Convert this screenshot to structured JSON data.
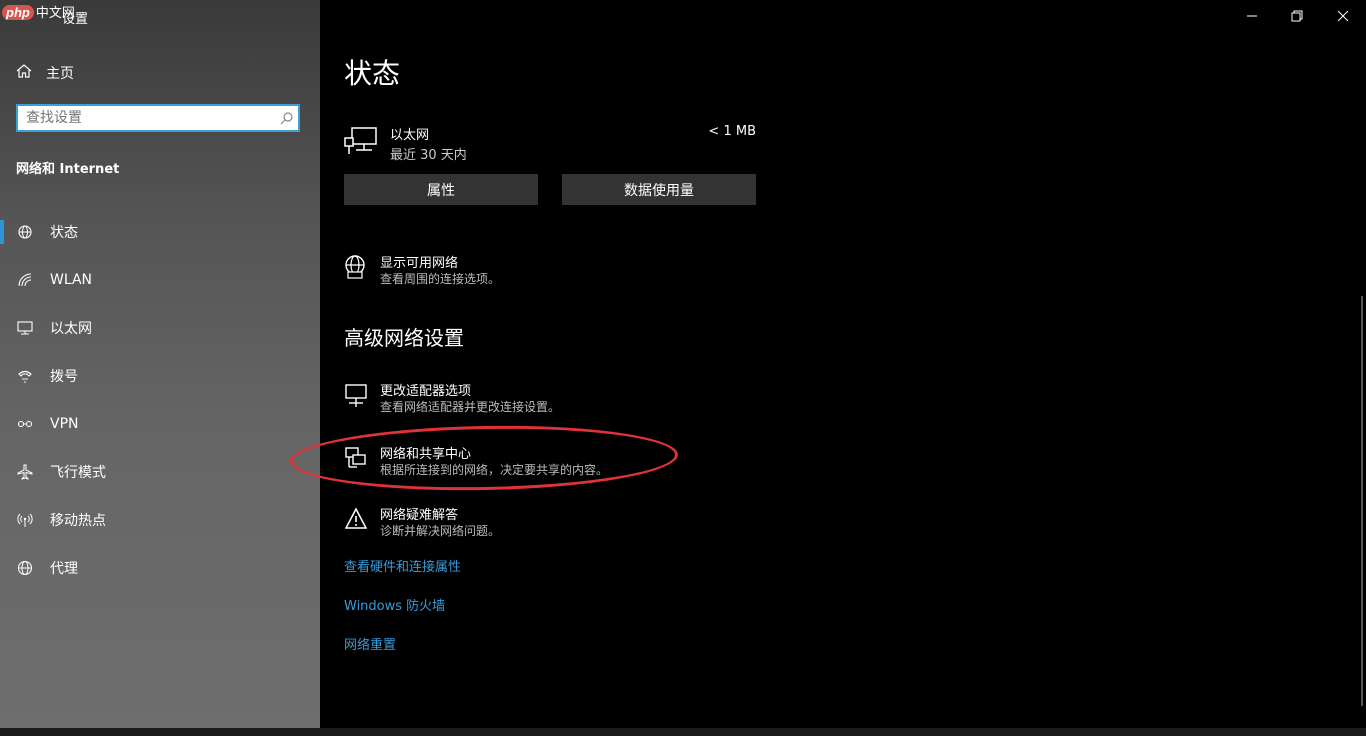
{
  "watermark": {
    "brand": "php",
    "site": "中文网"
  },
  "window": {
    "title": "设置"
  },
  "sidebar": {
    "home_label": "主页",
    "search_placeholder": "查找设置",
    "section_title": "网络和 Internet",
    "items": [
      {
        "label": "状态",
        "icon": "status-icon",
        "active": true
      },
      {
        "label": "WLAN",
        "icon": "wifi-icon"
      },
      {
        "label": "以太网",
        "icon": "ethernet-icon"
      },
      {
        "label": "拨号",
        "icon": "dialup-icon"
      },
      {
        "label": "VPN",
        "icon": "vpn-icon"
      },
      {
        "label": "飞行模式",
        "icon": "airplane-icon"
      },
      {
        "label": "移动热点",
        "icon": "hotspot-icon"
      },
      {
        "label": "代理",
        "icon": "globe-icon"
      }
    ]
  },
  "main": {
    "page_title": "状态",
    "ethernet": {
      "name": "以太网",
      "period": "最近 30 天内",
      "usage": "< 1 MB"
    },
    "buttons": {
      "properties": "属性",
      "data_usage": "数据使用量"
    },
    "show_networks": {
      "title": "显示可用网络",
      "subtitle": "查看周围的连接选项。"
    },
    "advanced_title": "高级网络设置",
    "advanced_items": [
      {
        "title": "更改适配器选项",
        "subtitle": "查看网络适配器并更改连接设置。"
      },
      {
        "title": "网络和共享中心",
        "subtitle": "根据所连接到的网络，决定要共享的内容。"
      },
      {
        "title": "网络疑难解答",
        "subtitle": "诊断并解决网络问题。"
      }
    ],
    "links": [
      "查看硬件和连接属性",
      "Windows 防火墙",
      "网络重置"
    ]
  },
  "colors": {
    "accent": "#2b95d6",
    "link": "#3a9ad9",
    "highlight": "#e03238"
  }
}
